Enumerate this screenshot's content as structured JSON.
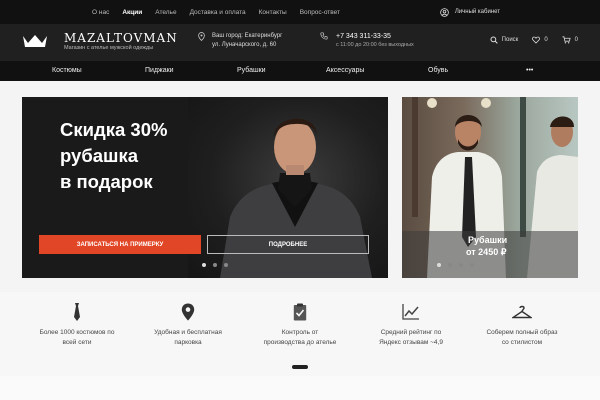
{
  "topbar": {
    "links": [
      "О нас",
      "Акции",
      "Ателье",
      "Доставка и оплата",
      "Контакты",
      "Вопрос-ответ"
    ],
    "active_link": "Акции",
    "cabinet": "Личный кабинет"
  },
  "header": {
    "brand": "MAZALTOVMAN",
    "tagline": "Магазин с ателье мужской одежды",
    "city_line1": "Ваш город: Екатеринбург",
    "city_line2": "ул. Луначарского, д. 60",
    "phone": "+7 343 311-33-35",
    "hours": "с 11:00 до 20:00 без выходных",
    "search_label": "Поиск",
    "wishlist_count": "0",
    "cart_count": "0"
  },
  "nav": {
    "items": [
      "Костюмы",
      "Пиджаки",
      "Рубашки",
      "Аксессуары",
      "Обувь",
      "•••"
    ]
  },
  "hero": {
    "title_line1": "Скидка 30%",
    "title_line2": "рубашка",
    "title_line3": "в подарок",
    "primary_button": "ЗАПИСАТЬСЯ НА ПРИМЕРКУ",
    "secondary_button": "ПОДРОБНЕЕ",
    "slides_count": 3,
    "active_slide": 0
  },
  "promo": {
    "title": "Рубашки",
    "price": "от 2450 ₽",
    "slides_count": 4,
    "active_slide": 0
  },
  "features": [
    {
      "icon": "tie-icon",
      "line1": "Более 1000 костюмов по",
      "line2": "всей сети"
    },
    {
      "icon": "location-pin-icon",
      "line1": "Удобная и бесплатная",
      "line2": "парковка"
    },
    {
      "icon": "clipboard-check-icon",
      "line1": "Контроль от",
      "line2": "производства до ателье"
    },
    {
      "icon": "chart-line-icon",
      "line1": "Средний рейтинг по",
      "line2": "Яндекс отзывам ~4,9"
    },
    {
      "icon": "hanger-icon",
      "line1": "Соберем полный образ",
      "line2": "со стилистом"
    }
  ],
  "colors": {
    "accent": "#e14726",
    "dark": "#111111",
    "header": "#202020"
  }
}
